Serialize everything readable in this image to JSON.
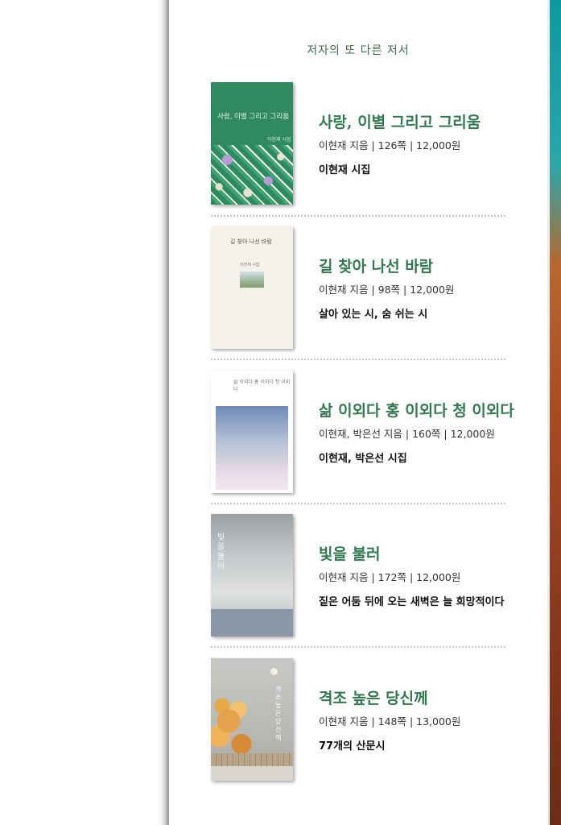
{
  "section": {
    "heading": "저자의 또 다른 저서"
  },
  "books": [
    {
      "title": "사랑, 이별 그리고 그리움",
      "meta": "이현재 지음 | 126쪽 | 12,000원",
      "tagline": "이현재 시집",
      "cover": {
        "title": "사랑, 이별 그리고 그리움",
        "author": "이현재 시집"
      }
    },
    {
      "title": "길 찾아 나선 바람",
      "meta": "이현재 지음 | 98쪽 | 12,000원",
      "tagline": "살아 있는 시, 숨 쉬는 시",
      "cover": {
        "title": "길 찾아 나선 바람",
        "author": "이현재 시집"
      }
    },
    {
      "title": "삶 이외다 홍 이외다 청 이외다",
      "meta": "이현재, 박은선 지음 | 160쪽 | 12,000원",
      "tagline": "이현재, 박은선 시집",
      "cover": {
        "title": "삶 이외다 홍 이외다 청 이외다"
      }
    },
    {
      "title": "빛을 불러",
      "meta": "이현재 지음 | 172쪽 | 12,000원",
      "tagline": "짙은 어둠 뒤에 오는 새벽은 늘 희망적이다",
      "cover": {
        "title": "빛을 불러"
      }
    },
    {
      "title": "격조 높은 당신께",
      "meta": "이현재 지음 | 148쪽 | 13,000원",
      "tagline": "77개의 산문시",
      "cover": {
        "title": "격조 높은 당신께"
      }
    }
  ],
  "colors": {
    "title_green": "#2f7a4f",
    "heading_green": "#3e6b4f"
  }
}
